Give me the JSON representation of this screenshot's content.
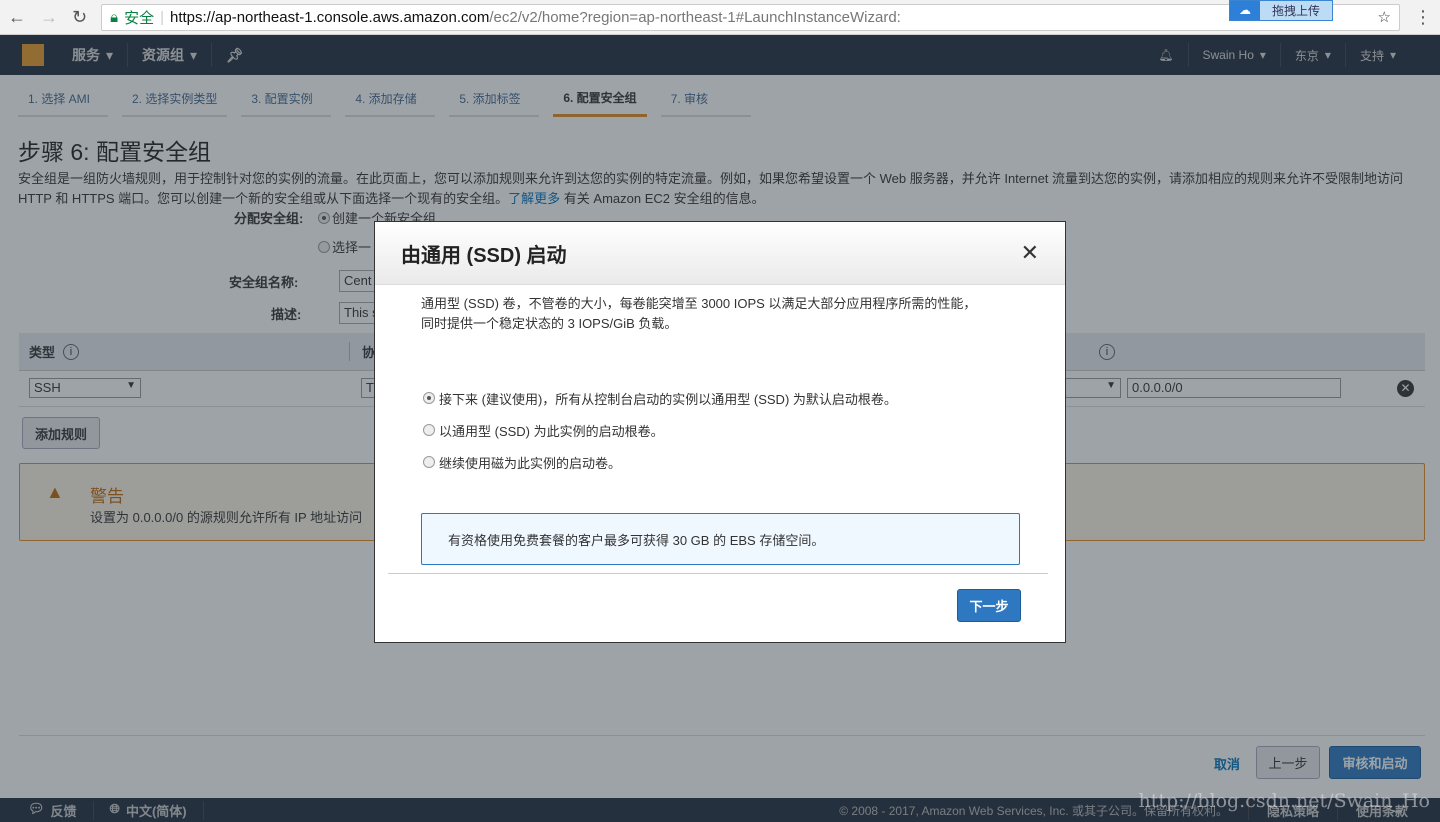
{
  "browser": {
    "secure_label": "安全",
    "url_host": "https://ap-northeast-1.console.aws.amazon.com",
    "url_path": "/ec2/v2/home?region=ap-northeast-1#LaunchInstanceWizard:",
    "extension_label": "拖拽上传"
  },
  "nav": {
    "services": "服务",
    "resource_groups": "资源组",
    "user": "Swain Ho",
    "region": "东京",
    "support": "支持"
  },
  "steps": [
    "1. 选择 AMI",
    "2. 选择实例类型",
    "3. 配置实例",
    "4. 添加存储",
    "5. 添加标签",
    "6. 配置安全组",
    "7. 审核"
  ],
  "active_step": 5,
  "page": {
    "title": "步骤 6: 配置安全组",
    "intro": "安全组是一组防火墙规则，用于控制针对您的实例的流量。在此页面上，您可以添加规则来允许到达您的实例的特定流量。例如，如果您希望设置一个 Web 服务器，并允许 Internet 流量到达您的实例，请添加相应的规则来允许不受限制地访问 HTTP 和 HTTPS 端口。您可以创建一个新的安全组或从下面选择一个现有的安全组。",
    "learn_more": "了解更多",
    "intro_tail": " 有关 Amazon EC2 安全组的信息。",
    "assign_label": "分配安全组:",
    "opt_create": "创建一个新安全组",
    "opt_select": "选择一",
    "name_label": "安全组名称:",
    "name_value": "Cent",
    "desc_label": "描述:",
    "desc_value": "This s",
    "col_type": "类型",
    "col_protocol": "协",
    "row_type": "SSH",
    "row_protocol": "T",
    "row_source": "义",
    "row_cidr": "0.0.0.0/0",
    "add_rule": "添加规则",
    "warning_title": "警告",
    "warning_text": "设置为 0.0.0.0/0 的源规则允许所有 IP 地址访问",
    "cancel": "取消",
    "previous": "上一步",
    "review_launch": "审核和启动"
  },
  "footer": {
    "feedback": "反馈",
    "language": "中文(简体)",
    "copyright": "© 2008 - 2017, Amazon Web Services, Inc. 或其子公司。保留所有权利。",
    "privacy": "隐私策略",
    "terms": "使用条款"
  },
  "watermark": "http://blog.csdn.net/Swain_Ho",
  "modal": {
    "title": "由通用 (SSD) 启动",
    "desc1": "通用型 (SSD) 卷，不管卷的大小，每卷能突增至 3000 IOPS 以满足大部分应用程序所需的性能，",
    "desc2": "同时提供一个稳定状态的 3 IOPS/GiB 负载。",
    "options": [
      "接下来 (建议使用)，所有从控制台启动的实例以通用型 (SSD) 为默认启动根卷。",
      "以通用型 (SSD) 为此实例的启动根卷。",
      "继续使用磁为此实例的启动卷。"
    ],
    "selected_option": 0,
    "free_tier": "有资格使用免费套餐的客户最多可获得 30 GB 的 EBS 存储空间。",
    "next": "下一步"
  },
  "colors": {
    "accent": "#e58d23",
    "primary": "#2d78c0",
    "nav_bg": "#232f3e"
  }
}
